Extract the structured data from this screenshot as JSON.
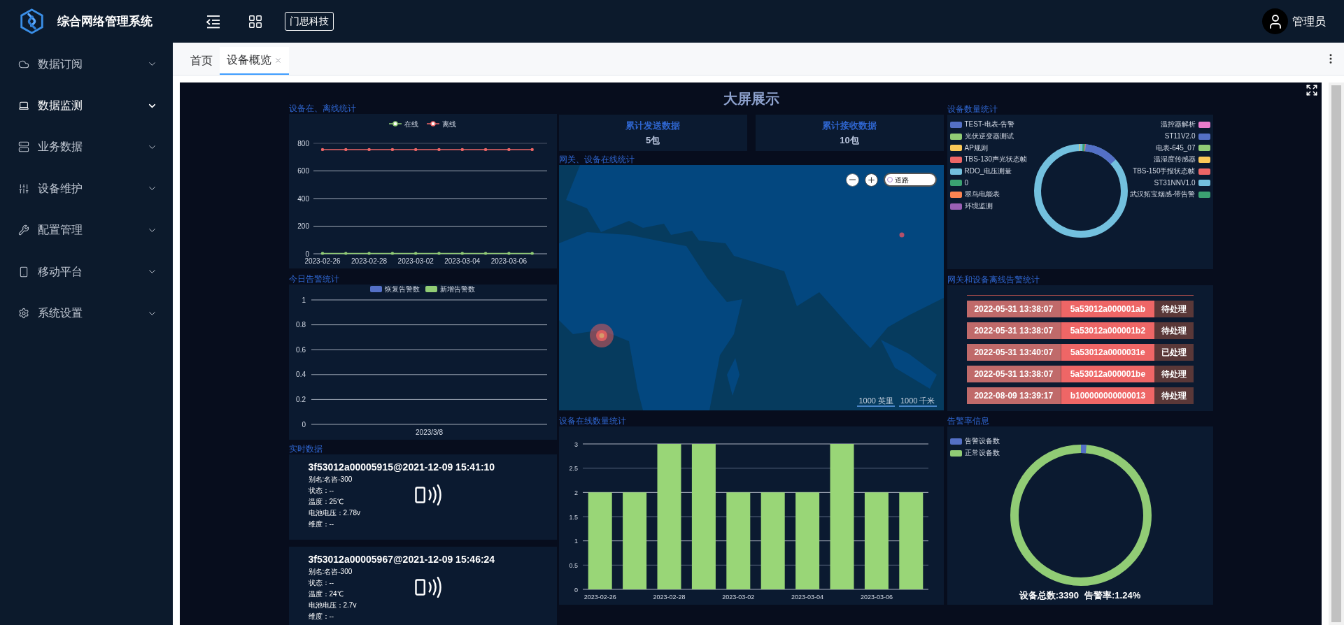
{
  "header": {
    "title": "综合网络管理系统",
    "company_button": "门思科技",
    "user_name": "管理员"
  },
  "sidebar": {
    "items": [
      {
        "label": "数据订阅",
        "selected": false
      },
      {
        "label": "数据监测",
        "selected": true
      },
      {
        "label": "业务数据",
        "selected": false
      },
      {
        "label": "设备维护",
        "selected": false
      },
      {
        "label": "配置管理",
        "selected": false
      },
      {
        "label": "移动平台",
        "selected": false
      },
      {
        "label": "系统设置",
        "selected": false
      }
    ]
  },
  "tabs": [
    {
      "label": "首页",
      "selected": false,
      "closable": false
    },
    {
      "label": "设备概览",
      "selected": true,
      "closable": true
    }
  ],
  "dashboard": {
    "title": "大屏展示",
    "online_offline": {
      "title": "设备在、离线统计",
      "chart_data": {
        "type": "line",
        "categories": [
          "2023-02-26",
          null,
          "2023-02-28",
          null,
          "2023-03-02",
          null,
          "2023-03-04",
          null,
          "2023-03-06",
          null
        ],
        "ylim": [
          0,
          800
        ],
        "yticks": [
          0,
          200,
          400,
          600,
          800
        ],
        "grid": true,
        "legend": "top",
        "series": [
          {
            "name": "在线",
            "color": "#91cc75",
            "values": [
              3,
              3,
              3,
              3,
              3,
              3,
              3,
              3,
              3,
              3
            ]
          },
          {
            "name": "离线",
            "color": "#ee6666",
            "values": [
              755,
              755,
              755,
              755,
              755,
              755,
              755,
              755,
              755,
              755
            ]
          }
        ]
      }
    },
    "today_alarms": {
      "title": "今日告警统计",
      "chart_data": {
        "type": "bar",
        "categories": [
          "2023/3/8"
        ],
        "ylim": [
          0,
          1
        ],
        "yticks": [
          0,
          0.2,
          0.4,
          0.6,
          0.8,
          1
        ],
        "grid": true,
        "legend": "top",
        "series": [
          {
            "name": "恢复告警数",
            "color": "#5470c6",
            "values": [
              0
            ]
          },
          {
            "name": "新增告警数",
            "color": "#91cc75",
            "values": [
              0
            ]
          }
        ]
      }
    },
    "realtime": {
      "title": "实时数据",
      "cards": [
        {
          "title": "3f53012a00005915@2021-12-09 15:41:10",
          "lines": [
            "别名:名咨-300",
            "状态：--",
            "温度：25℃",
            "电池电压：2.78v",
            "维度：--"
          ]
        },
        {
          "title": "3f53012a00005967@2021-12-09 15:46:24",
          "lines": [
            "别名:名咨-300",
            "状态：--",
            "温度：24℃",
            "电池电压：2.7v",
            "维度：--"
          ]
        }
      ]
    },
    "stats": [
      {
        "label": "累计发送数据",
        "value": "5包"
      },
      {
        "label": "累计接收数据",
        "value": "10包"
      }
    ],
    "map": {
      "title": "网关、设备在线统计",
      "layer_toggle": "道路",
      "scales": [
        "1000 英里",
        "1000 千米"
      ]
    },
    "online_count": {
      "title": "设备在线数量统计",
      "chart_data": {
        "type": "bar",
        "categories": [
          "2023-02-26",
          null,
          "2023-02-28",
          null,
          "2023-03-02",
          null,
          "2023-03-04",
          null,
          "2023-03-06",
          null
        ],
        "ylim": [
          0,
          3
        ],
        "yticks": [
          0,
          0.5,
          1,
          1.5,
          2,
          2.5,
          3
        ],
        "grid": true,
        "values": [
          2,
          2,
          3,
          3,
          2,
          2,
          2,
          3,
          2,
          2
        ]
      }
    },
    "device_counts": {
      "title": "设备数量统计",
      "legend_left": [
        {
          "label": "TEST-电表-告警",
          "color": "#5470c6"
        },
        {
          "label": "光伏逆变器测试",
          "color": "#91cc75"
        },
        {
          "label": "AP规则",
          "color": "#fac858"
        },
        {
          "label": "TBS-130声光状态帧",
          "color": "#ee6666"
        },
        {
          "label": "RDO_电压测量",
          "color": "#73c0de"
        },
        {
          "label": "0",
          "color": "#3ba272"
        },
        {
          "label": "翠鸟电能表",
          "color": "#fc8452"
        },
        {
          "label": "环境监测",
          "color": "#9a60b4"
        }
      ],
      "legend_right": [
        {
          "label": "温控器解析",
          "color": "#ea7ccc"
        },
        {
          "label": "ST11V2.0",
          "color": "#5470c6"
        },
        {
          "label": "电表-645_07",
          "color": "#91cc75"
        },
        {
          "label": "温湿度传感器",
          "color": "#fac858"
        },
        {
          "label": "TBS-150手报状态帧",
          "color": "#ee6666"
        },
        {
          "label": "ST31NNV1.0",
          "color": "#73c0de"
        },
        {
          "label": "武汉拓宝烟感-带告警",
          "color": "#3ba272"
        }
      ]
    },
    "offline_alarms": {
      "title": "网关和设备离线告警统计",
      "rows": [
        {
          "time": "2022-05-31 13:38:07",
          "device": "5a53012a000001ab",
          "status": "待处理"
        },
        {
          "time": "2022-05-31 13:38:07",
          "device": "5a53012a000001b2",
          "status": "待处理"
        },
        {
          "time": "2022-05-31 13:40:07",
          "device": "5a53012a0000031e",
          "status": "已处理"
        },
        {
          "time": "2022-05-31 13:38:07",
          "device": "5a53012a000001be",
          "status": "待处理"
        },
        {
          "time": "2022-08-09 13:39:17",
          "device": "b100000000000013",
          "status": "待处理"
        }
      ]
    },
    "alarm_rate": {
      "title": "告警率信息",
      "legend": [
        {
          "label": "告警设备数",
          "color": "#5470c6"
        },
        {
          "label": "正常设备数",
          "color": "#91cc75"
        }
      ],
      "total": "设备总数:3390",
      "rate": "告警率:1.24%"
    }
  }
}
